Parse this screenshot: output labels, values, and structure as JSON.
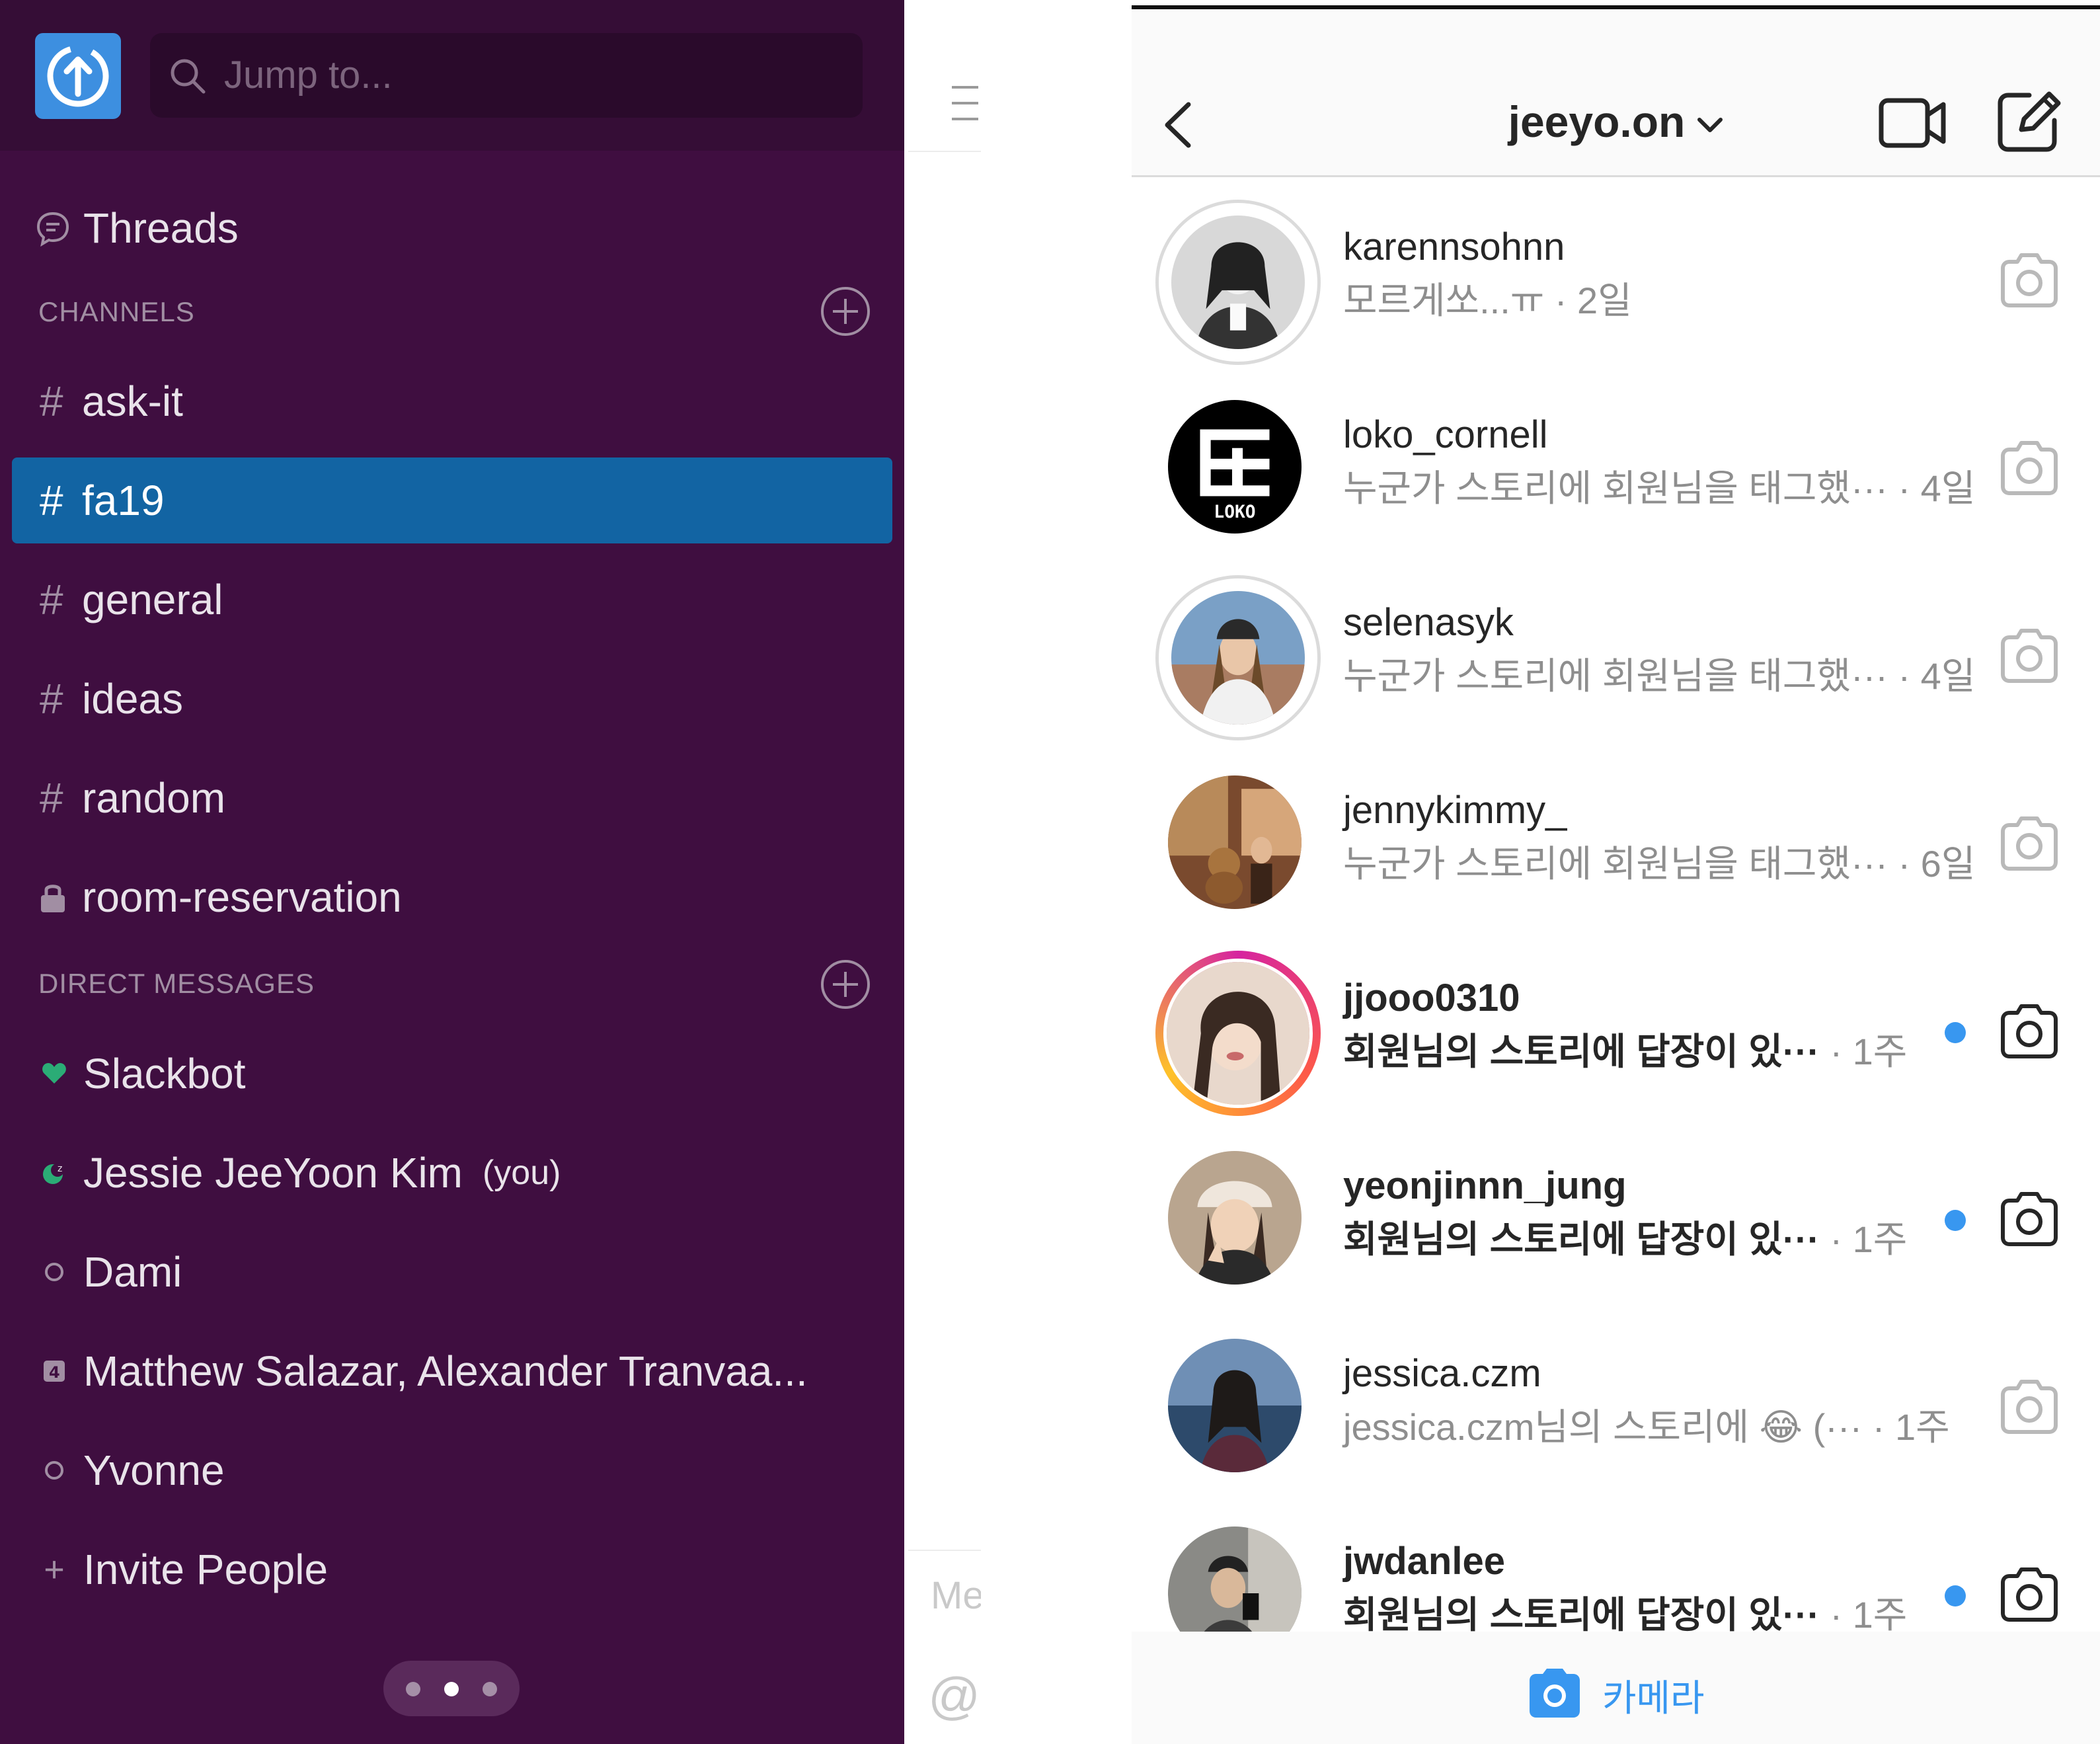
{
  "slack": {
    "search_placeholder": "Jump to...",
    "threads_label": "Threads",
    "channels_header": "CHANNELS",
    "channels": [
      {
        "prefix": "#",
        "name": "ask-it"
      },
      {
        "prefix": "#",
        "name": "fa19",
        "active": true
      },
      {
        "prefix": "#",
        "name": "general"
      },
      {
        "prefix": "#",
        "name": "ideas"
      },
      {
        "prefix": "#",
        "name": "random"
      },
      {
        "prefix": "lock",
        "name": "room-reservation"
      }
    ],
    "dm_header": "DIRECT MESSAGES",
    "dms": [
      {
        "name": "Slackbot",
        "presence": "heart"
      },
      {
        "name": "Jessie JeeYoon Kim",
        "suffix": "(you)",
        "presence": "away-dnd"
      },
      {
        "name": "Dami",
        "presence": "away"
      },
      {
        "name": "Matthew Salazar, Alexander Tranvaa...",
        "presence": "group-4"
      },
      {
        "name": "Yvonne",
        "presence": "away"
      }
    ],
    "invite_label": "Invite People",
    "invite_prefix": "+",
    "colors": {
      "sidebar": "#3f0e40",
      "active": "#1264a3"
    }
  },
  "middle": {
    "message_stub": "Me",
    "at_stub": "@"
  },
  "instagram": {
    "title": "jeeyo.on",
    "threads": [
      {
        "user": "karennsohnn",
        "preview": "모르게쏘...ㅠ",
        "ago": "· 2일",
        "unread": false,
        "ring": "seen"
      },
      {
        "user": "loko_cornell",
        "preview": "누군가 스토리에 회원님을 태그했···",
        "ago": "· 4일",
        "unread": false,
        "ring": "none"
      },
      {
        "user": "selenasyk",
        "preview": "누군가 스토리에 회원님을 태그했···",
        "ago": "· 4일",
        "unread": false,
        "ring": "seen"
      },
      {
        "user": "jennykimmy_",
        "preview": "누군가 스토리에 회원님을 태그했···",
        "ago": "· 6일",
        "unread": false,
        "ring": "none"
      },
      {
        "user": "jjooo0310",
        "preview": "회원님의 스토리에 답장이 있···",
        "ago": " · 1주",
        "unread": true,
        "ring": "story"
      },
      {
        "user": "yeonjinnn_jung",
        "preview": "회원님의 스토리에 답장이 있···",
        "ago": " · 1주",
        "unread": true,
        "ring": "none"
      },
      {
        "user": "jessica.czm",
        "preview": "jessica.czm님의 스토리에 😂 (···",
        "ago": " · 1주",
        "unread": false,
        "ring": "none"
      },
      {
        "user": "jwdanlee",
        "preview": "회원님의 스토리에 답장이 있···",
        "ago": " · 1주",
        "unread": true,
        "ring": "none"
      }
    ],
    "footer_label": "카메라",
    "colors": {
      "accent": "#3897f0",
      "unread_dot": "#3897f0"
    }
  }
}
